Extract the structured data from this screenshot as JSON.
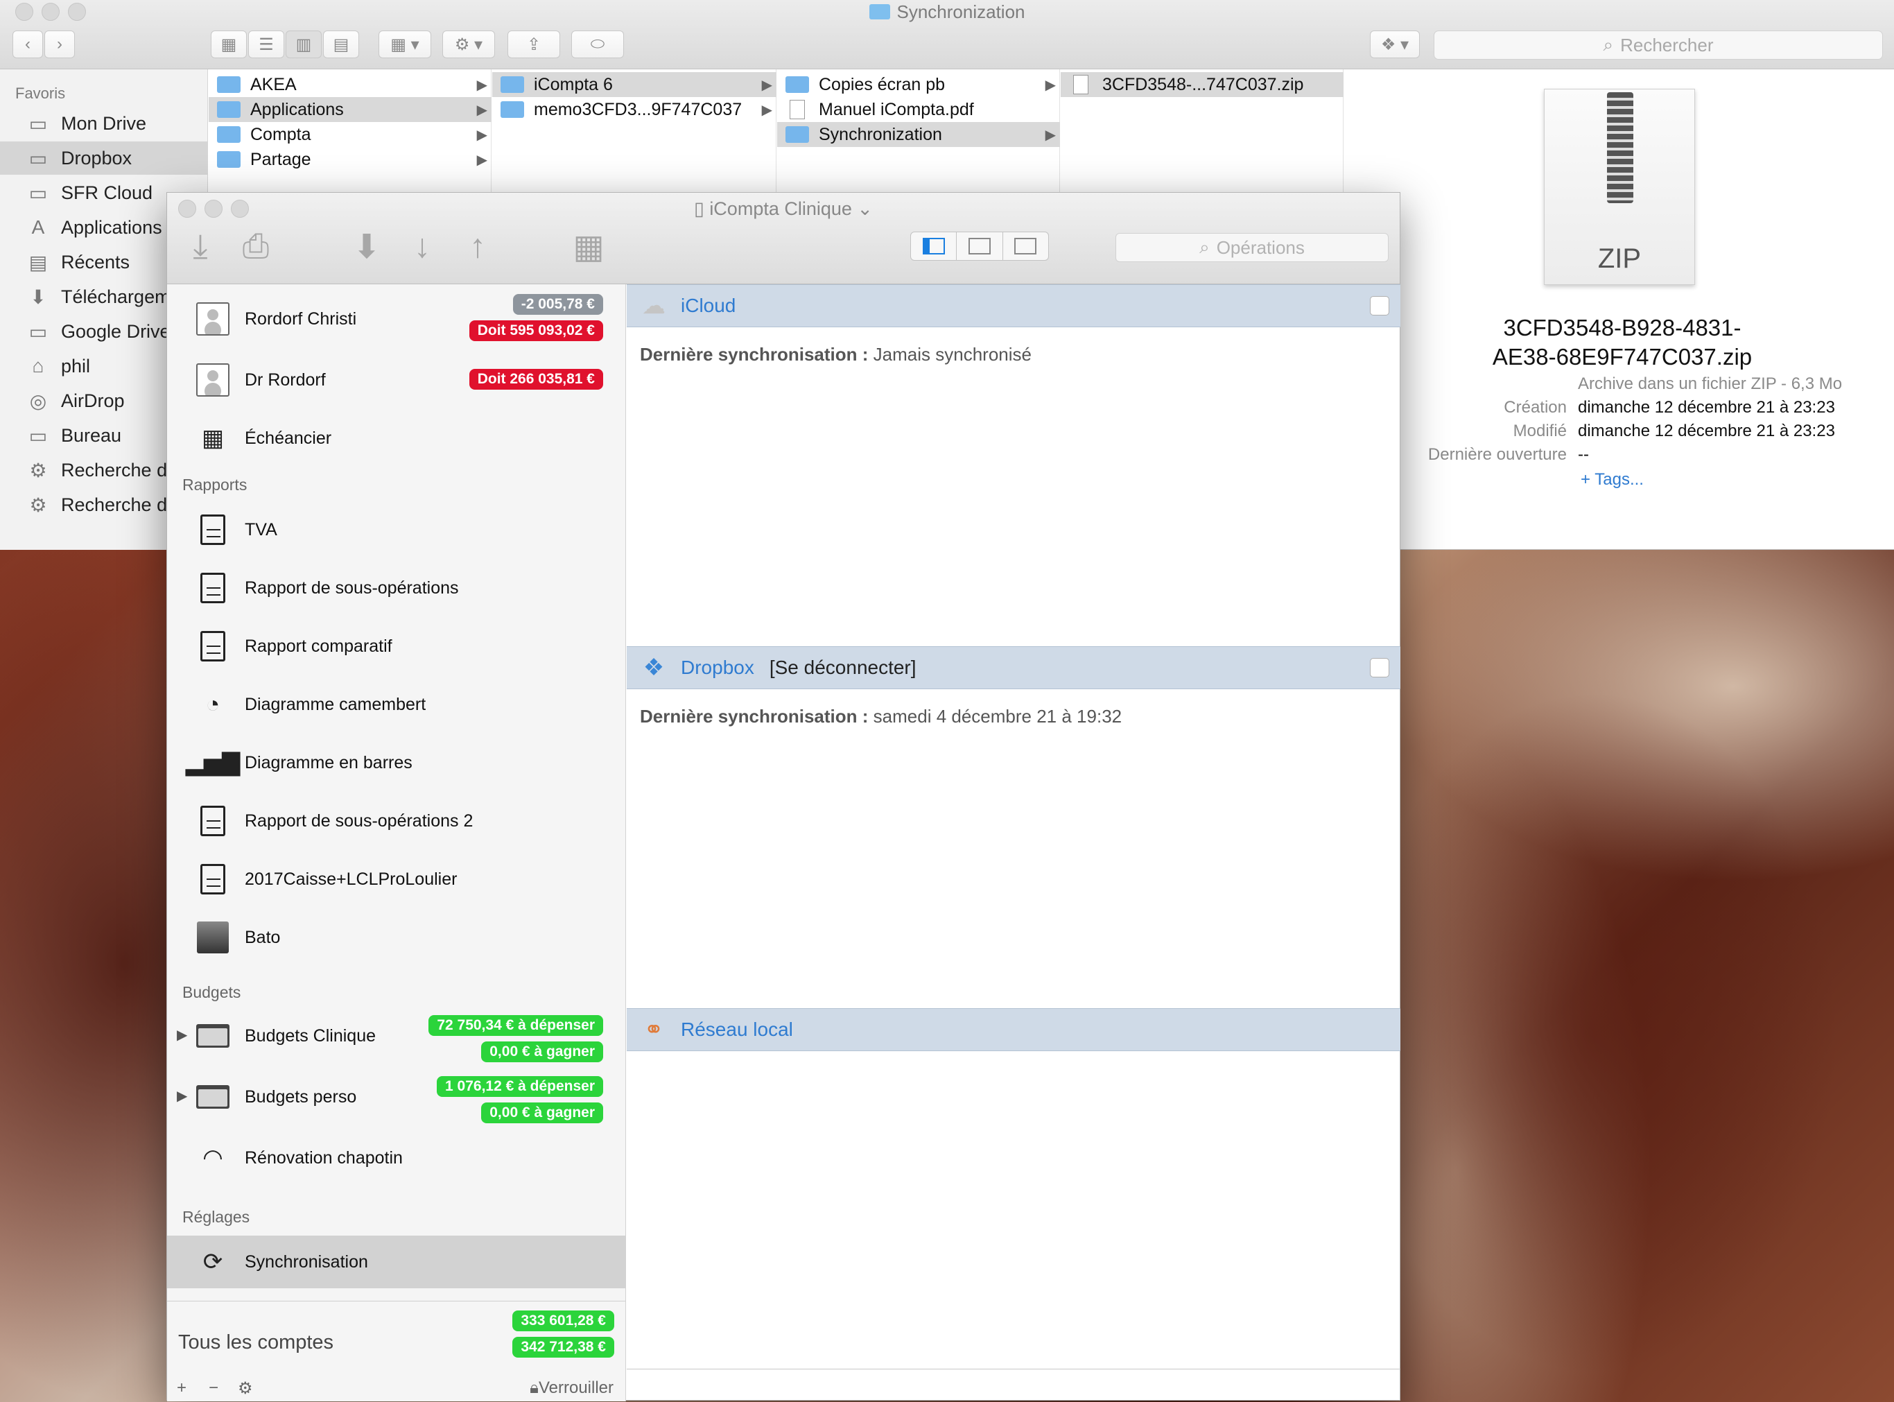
{
  "finder": {
    "title": "Synchronization",
    "search_placeholder": "Rechercher",
    "sidebar": {
      "section": "Favoris",
      "items": [
        {
          "label": "Mon Drive",
          "icon": "drive-icon"
        },
        {
          "label": "Dropbox",
          "icon": "folder-icon",
          "selected": true
        },
        {
          "label": "SFR Cloud",
          "icon": "folder-icon"
        },
        {
          "label": "Applications",
          "icon": "applications-icon"
        },
        {
          "label": "Récents",
          "icon": "recents-icon"
        },
        {
          "label": "Téléchargem",
          "icon": "download-icon"
        },
        {
          "label": "Google Drive",
          "icon": "folder-icon"
        },
        {
          "label": "phil",
          "icon": "home-icon"
        },
        {
          "label": "AirDrop",
          "icon": "airdrop-icon"
        },
        {
          "label": "Bureau",
          "icon": "desktop-icon"
        },
        {
          "label": "Recherche d",
          "icon": "gear-icon"
        },
        {
          "label": "Recherche d",
          "icon": "gear-icon"
        }
      ]
    },
    "columns": [
      {
        "items": [
          {
            "label": "AKEA",
            "selected": false
          },
          {
            "label": "Applications",
            "selected": true
          },
          {
            "label": "Compta",
            "selected": false
          },
          {
            "label": "Partage",
            "selected": false
          }
        ]
      },
      {
        "items": [
          {
            "label": "iCompta 6",
            "selected": true
          },
          {
            "label": "memo3CFD3...9F747C037",
            "selected": false
          }
        ]
      },
      {
        "items": [
          {
            "label": "Copies écran pb",
            "selected": false
          },
          {
            "label": "Manuel iCompta.pdf",
            "selected": false,
            "doc": true
          },
          {
            "label": "Synchronization",
            "selected": true
          }
        ]
      },
      {
        "items": [
          {
            "label": "3CFD3548-...747C037.zip",
            "selected": true
          }
        ]
      }
    ],
    "preview": {
      "icon_label": "ZIP",
      "name_line1": "3CFD3548-B928-4831-",
      "name_line2": "AE38-68E9F747C037.zip",
      "kind": "Archive dans un fichier ZIP - 6,3 Mo",
      "created_label": "Création",
      "created_value": "dimanche 12 décembre 21 à 23:23",
      "modified_label": "Modifié",
      "modified_value": "dimanche 12 décembre 21 à 23:23",
      "opened_label": "Dernière ouverture",
      "opened_value": "--",
      "tags_link": "+ Tags..."
    }
  },
  "icompta": {
    "title": "iCompta Clinique",
    "search_placeholder": "Opérations",
    "accounts": [
      {
        "label": "Rordorf Christi",
        "badges": [
          {
            "text": "-2 005,78 €",
            "color": "gray"
          },
          {
            "text": "Doit 595 093,02 €",
            "color": "red"
          }
        ]
      },
      {
        "label": "Dr Rordorf",
        "badges": [
          {
            "text": "Doit 266 035,81 €",
            "color": "red"
          }
        ]
      },
      {
        "label": "Échéancier"
      }
    ],
    "reports_header": "Rapports",
    "reports": [
      "TVA",
      "Rapport de sous-opérations",
      "Rapport comparatif",
      "Diagramme camembert",
      "Diagramme en barres",
      "Rapport de sous-opérations 2",
      "2017Caisse+LCLProLoulier",
      "Bato"
    ],
    "budgets_header": "Budgets",
    "budgets": [
      {
        "label": "Budgets Clinique",
        "spend": "72 750,34 € à dépenser",
        "earn": "0,00 € à gagner"
      },
      {
        "label": "Budgets perso",
        "spend": "1 076,12 € à dépenser",
        "earn": "0,00 € à gagner"
      },
      {
        "label": "Rénovation chapotin"
      }
    ],
    "settings_header": "Réglages",
    "settings_item": "Synchronisation",
    "all_accounts_label": "Tous les comptes",
    "total_1": "333 601,28 €",
    "total_2": "342 712,38 €",
    "bottom": {
      "add": "+",
      "remove": "−",
      "gear": "⚙",
      "lock_label": "Verrouiller"
    },
    "sync": {
      "last_sync_label": "Dernière synchronisation :",
      "icloud": {
        "title": "iCloud",
        "status": "Jamais synchronisé"
      },
      "dropbox": {
        "title": "Dropbox",
        "link": "[Se déconnecter]",
        "status": "samedi 4 décembre 21 à 19:32"
      },
      "local": {
        "title": "Réseau local"
      }
    }
  },
  "colors": {
    "accent": "#2f7bd0",
    "red_badge": "#e0112d",
    "green_badge": "#2bd43b",
    "gray_badge": "#8e959d",
    "panel_header": "#cfdae7"
  }
}
